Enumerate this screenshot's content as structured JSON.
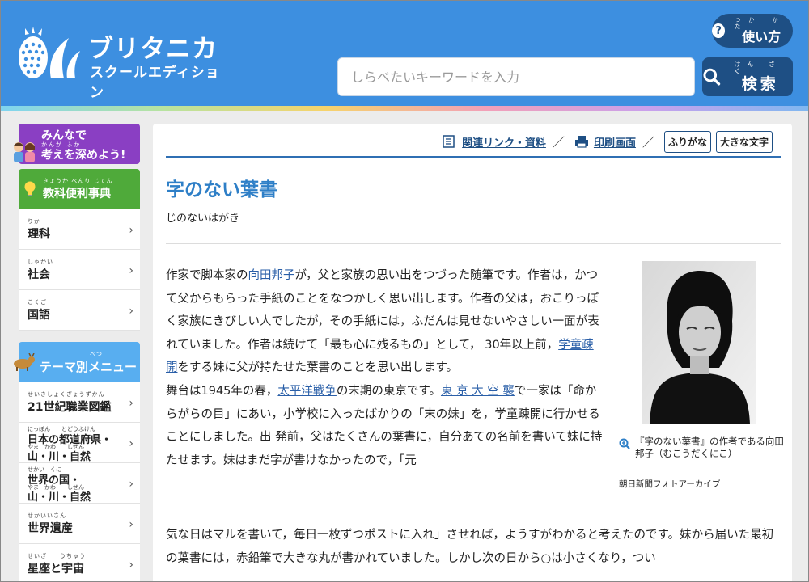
{
  "header": {
    "logo_title": "ブリタニカ",
    "logo_subtitle": "スクールエディション",
    "search_placeholder": "しらべたいキーワードを入力",
    "search_button": "検索",
    "search_button_ruby": "けん さく",
    "help_button": "使い方",
    "help_button_ruby": "つか かた"
  },
  "sidebar": {
    "banner_line1": "みんなで",
    "banner_ruby": "かんが   ふか",
    "banner_line2": "考えを深めよう!",
    "dictionary_heading": "教科便利事典",
    "dictionary_heading_ruby": "きょうか べんり じてん",
    "subjects": [
      {
        "ruby": "りか",
        "label": "理科"
      },
      {
        "ruby": "しゃかい",
        "label": "社会"
      },
      {
        "ruby": "こくご",
        "label": "国語"
      }
    ],
    "theme_heading": "テーマ別メニュー",
    "theme_heading_ruby": "べつ",
    "themes": [
      {
        "ruby": "せいきしょくぎょうずかん",
        "label": "21世紀職業図鑑"
      },
      {
        "ruby1": "にっぽん　　とどうふけん",
        "label1": "日本の都道府県・",
        "ruby2": "やま　かわ　　しぜん",
        "label2": "山・川・自然"
      },
      {
        "ruby1": "せかい　くに",
        "label1": "世界の国・",
        "ruby2": "やま　かわ　　しぜん",
        "label2": "山・川・自然"
      },
      {
        "ruby": "せかいいさん",
        "label": "世界遺産"
      },
      {
        "ruby": "せいざ　　うちゅう",
        "label": "星座と宇宙"
      }
    ]
  },
  "toolbar": {
    "related_links": "関連リンク・資料",
    "print_view": "印刷画面",
    "furigana": "ふりがな",
    "large_text": "大きな文字"
  },
  "article": {
    "title": "字のない葉書",
    "reading": "じのないはがき",
    "p1_a": "作家で脚本家の",
    "p1_link1": "向田邦子",
    "p1_b": "が，父と家族の思い出をつづった随筆です。作者は，かつて父からもらった手紙のことをなつかしく思い出します。作者の父は，おこりっぽく家族にきびしい人でしたが，その手紙には，ふだんは見せないやさしい一面が表れていました。作者は続けて「最も心に残るもの」として， 30年以上前，",
    "p1_link2": "学童疎開",
    "p1_c": "をする妹に父が持たせた葉書のことを思い出します。",
    "p2_a": "舞台は1945年の春，",
    "p2_link1": "太平洋戦争",
    "p2_b": "の末期の東京です。",
    "p2_link2": "東 京 大 空 襲",
    "p2_c": "で一家は「命からがらの目」にあい，小学校に入ったばかりの「末の妹」を，学童疎開に行かせることにしました。出 発前，父はたくさんの葉書に，自分あての名前を書いて妹に持たせます。妹はまだ字が書けなかったので，「元",
    "p3": "気な日はマルを書いて，毎日一枚ずつポストに入れ」させれば，ようすがわかると考えたのです。妹から届いた最初の葉書には，赤鉛筆で大きな丸が書かれていました。しかし次の日から○は小さくなり，つい",
    "photo_caption": "『字のない葉書』の作者である向田邦子（むこうだくにこ）",
    "photo_credit": "朝日新聞フォトアーカイブ"
  },
  "colors": {
    "header_blue": "#3d8fe0",
    "dark_navy": "#1e4f84",
    "title_blue": "#2e7fc7",
    "purple_banner": "#8a3fc3",
    "green_heading": "#4faa3a",
    "light_blue_heading": "#58aef0"
  }
}
